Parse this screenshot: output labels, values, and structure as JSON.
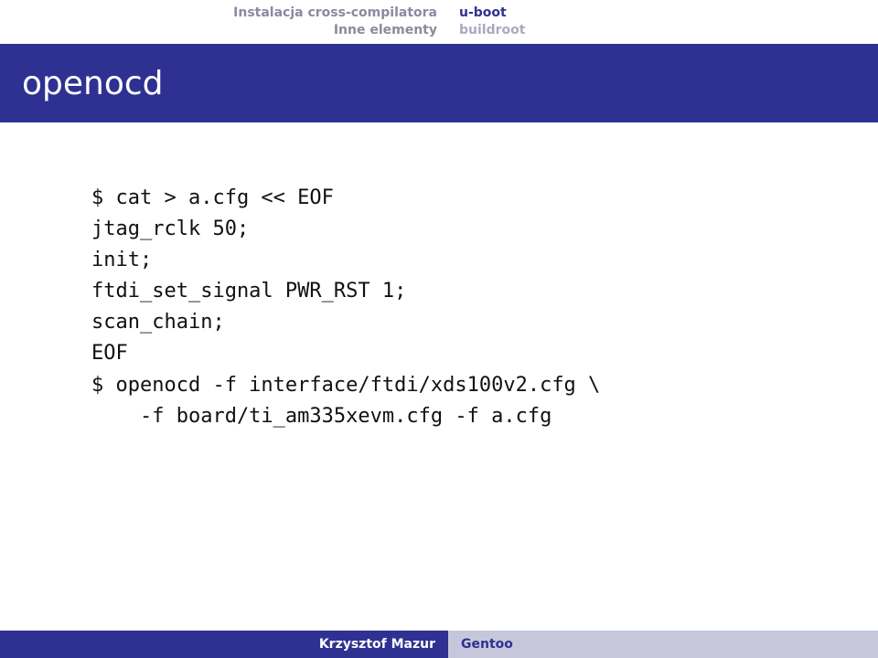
{
  "nav": {
    "left": {
      "line1": "Instalacja cross-compilatora",
      "line2": "Inne elementy"
    },
    "right": {
      "line1": "u-boot",
      "line2": "buildroot"
    }
  },
  "title": "openocd",
  "code_lines": [
    "$ cat > a.cfg << EOF",
    "jtag_rclk 50;",
    "init;",
    "ftdi_set_signal PWR_RST 1;",
    "scan_chain;",
    "EOF",
    "$ openocd -f interface/ftdi/xds100v2.cfg \\",
    "    -f board/ti_am335xevm.cfg -f a.cfg"
  ],
  "footer": {
    "author": "Krzysztof Mazur",
    "short_title": "Gentoo"
  }
}
